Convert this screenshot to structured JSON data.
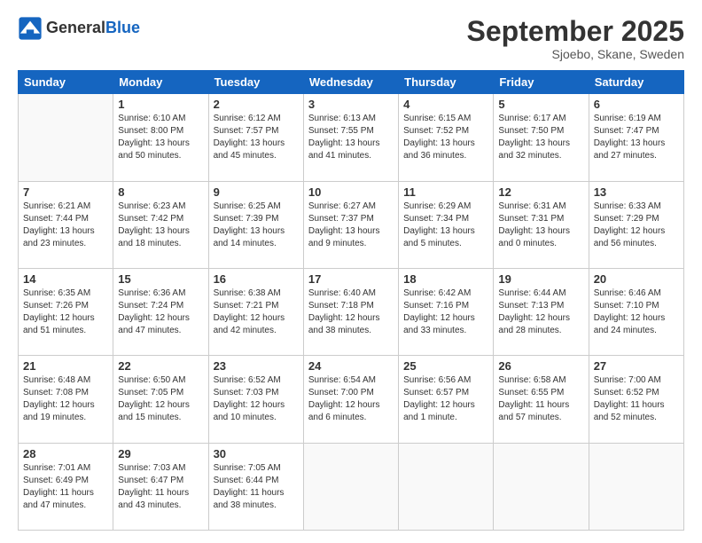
{
  "header": {
    "logo_general": "General",
    "logo_blue": "Blue",
    "month_title": "September 2025",
    "subtitle": "Sjoebo, Skane, Sweden"
  },
  "days_of_week": [
    "Sunday",
    "Monday",
    "Tuesday",
    "Wednesday",
    "Thursday",
    "Friday",
    "Saturday"
  ],
  "weeks": [
    [
      {
        "day": "",
        "info": ""
      },
      {
        "day": "1",
        "info": "Sunrise: 6:10 AM\nSunset: 8:00 PM\nDaylight: 13 hours\nand 50 minutes."
      },
      {
        "day": "2",
        "info": "Sunrise: 6:12 AM\nSunset: 7:57 PM\nDaylight: 13 hours\nand 45 minutes."
      },
      {
        "day": "3",
        "info": "Sunrise: 6:13 AM\nSunset: 7:55 PM\nDaylight: 13 hours\nand 41 minutes."
      },
      {
        "day": "4",
        "info": "Sunrise: 6:15 AM\nSunset: 7:52 PM\nDaylight: 13 hours\nand 36 minutes."
      },
      {
        "day": "5",
        "info": "Sunrise: 6:17 AM\nSunset: 7:50 PM\nDaylight: 13 hours\nand 32 minutes."
      },
      {
        "day": "6",
        "info": "Sunrise: 6:19 AM\nSunset: 7:47 PM\nDaylight: 13 hours\nand 27 minutes."
      }
    ],
    [
      {
        "day": "7",
        "info": "Sunrise: 6:21 AM\nSunset: 7:44 PM\nDaylight: 13 hours\nand 23 minutes."
      },
      {
        "day": "8",
        "info": "Sunrise: 6:23 AM\nSunset: 7:42 PM\nDaylight: 13 hours\nand 18 minutes."
      },
      {
        "day": "9",
        "info": "Sunrise: 6:25 AM\nSunset: 7:39 PM\nDaylight: 13 hours\nand 14 minutes."
      },
      {
        "day": "10",
        "info": "Sunrise: 6:27 AM\nSunset: 7:37 PM\nDaylight: 13 hours\nand 9 minutes."
      },
      {
        "day": "11",
        "info": "Sunrise: 6:29 AM\nSunset: 7:34 PM\nDaylight: 13 hours\nand 5 minutes."
      },
      {
        "day": "12",
        "info": "Sunrise: 6:31 AM\nSunset: 7:31 PM\nDaylight: 13 hours\nand 0 minutes."
      },
      {
        "day": "13",
        "info": "Sunrise: 6:33 AM\nSunset: 7:29 PM\nDaylight: 12 hours\nand 56 minutes."
      }
    ],
    [
      {
        "day": "14",
        "info": "Sunrise: 6:35 AM\nSunset: 7:26 PM\nDaylight: 12 hours\nand 51 minutes."
      },
      {
        "day": "15",
        "info": "Sunrise: 6:36 AM\nSunset: 7:24 PM\nDaylight: 12 hours\nand 47 minutes."
      },
      {
        "day": "16",
        "info": "Sunrise: 6:38 AM\nSunset: 7:21 PM\nDaylight: 12 hours\nand 42 minutes."
      },
      {
        "day": "17",
        "info": "Sunrise: 6:40 AM\nSunset: 7:18 PM\nDaylight: 12 hours\nand 38 minutes."
      },
      {
        "day": "18",
        "info": "Sunrise: 6:42 AM\nSunset: 7:16 PM\nDaylight: 12 hours\nand 33 minutes."
      },
      {
        "day": "19",
        "info": "Sunrise: 6:44 AM\nSunset: 7:13 PM\nDaylight: 12 hours\nand 28 minutes."
      },
      {
        "day": "20",
        "info": "Sunrise: 6:46 AM\nSunset: 7:10 PM\nDaylight: 12 hours\nand 24 minutes."
      }
    ],
    [
      {
        "day": "21",
        "info": "Sunrise: 6:48 AM\nSunset: 7:08 PM\nDaylight: 12 hours\nand 19 minutes."
      },
      {
        "day": "22",
        "info": "Sunrise: 6:50 AM\nSunset: 7:05 PM\nDaylight: 12 hours\nand 15 minutes."
      },
      {
        "day": "23",
        "info": "Sunrise: 6:52 AM\nSunset: 7:03 PM\nDaylight: 12 hours\nand 10 minutes."
      },
      {
        "day": "24",
        "info": "Sunrise: 6:54 AM\nSunset: 7:00 PM\nDaylight: 12 hours\nand 6 minutes."
      },
      {
        "day": "25",
        "info": "Sunrise: 6:56 AM\nSunset: 6:57 PM\nDaylight: 12 hours\nand 1 minute."
      },
      {
        "day": "26",
        "info": "Sunrise: 6:58 AM\nSunset: 6:55 PM\nDaylight: 11 hours\nand 57 minutes."
      },
      {
        "day": "27",
        "info": "Sunrise: 7:00 AM\nSunset: 6:52 PM\nDaylight: 11 hours\nand 52 minutes."
      }
    ],
    [
      {
        "day": "28",
        "info": "Sunrise: 7:01 AM\nSunset: 6:49 PM\nDaylight: 11 hours\nand 47 minutes."
      },
      {
        "day": "29",
        "info": "Sunrise: 7:03 AM\nSunset: 6:47 PM\nDaylight: 11 hours\nand 43 minutes."
      },
      {
        "day": "30",
        "info": "Sunrise: 7:05 AM\nSunset: 6:44 PM\nDaylight: 11 hours\nand 38 minutes."
      },
      {
        "day": "",
        "info": ""
      },
      {
        "day": "",
        "info": ""
      },
      {
        "day": "",
        "info": ""
      },
      {
        "day": "",
        "info": ""
      }
    ]
  ]
}
